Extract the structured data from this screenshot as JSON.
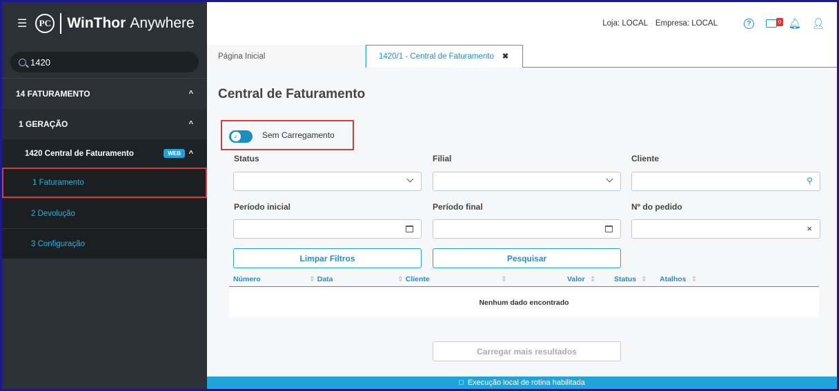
{
  "app": {
    "brand_bold": "WinThor",
    "brand_light": "Anywhere",
    "logo_text": "PC"
  },
  "sidebar": {
    "search_value": "1420",
    "module": "14  FATURAMENTO",
    "group": "1  GERAÇÃO",
    "routine": "1420  Central de Faturamento",
    "routine_badge": "WEB",
    "items": [
      {
        "label": "1  Faturamento"
      },
      {
        "label": "2  Devolução"
      },
      {
        "label": "3  Configuração"
      }
    ]
  },
  "topbar": {
    "loja": "Loja: LOCAL",
    "empresa": "Empresa: LOCAL",
    "mail_count": "0"
  },
  "tabs": [
    {
      "label": "Página Inicial"
    },
    {
      "label": "1420/1 - Central de Faturamento"
    }
  ],
  "page": {
    "title": "Central de Faturamento",
    "toggle_label": "Sem Carregamento"
  },
  "filters": {
    "status_label": "Status",
    "filial_label": "Filial",
    "cliente_label": "Cliente",
    "periodo_inicial_label": "Período inicial",
    "periodo_final_label": "Período final",
    "pedido_label": "Nº do pedido"
  },
  "buttons": {
    "limpar": "Limpar Filtros",
    "pesquisar": "Pesquisar",
    "carregar": "Carregar mais resultados"
  },
  "table": {
    "columns": [
      "Número",
      "Data",
      "Cliente",
      "Valor",
      "Status",
      "Atalhos"
    ],
    "empty_message": "Nenhum dado encontrado"
  },
  "footer": {
    "message": "Execução local de rotina habilitada"
  },
  "colors": {
    "accent": "#1fa3d8",
    "sidebar_bg": "#2b3136",
    "highlight_border": "#d63a3a"
  }
}
